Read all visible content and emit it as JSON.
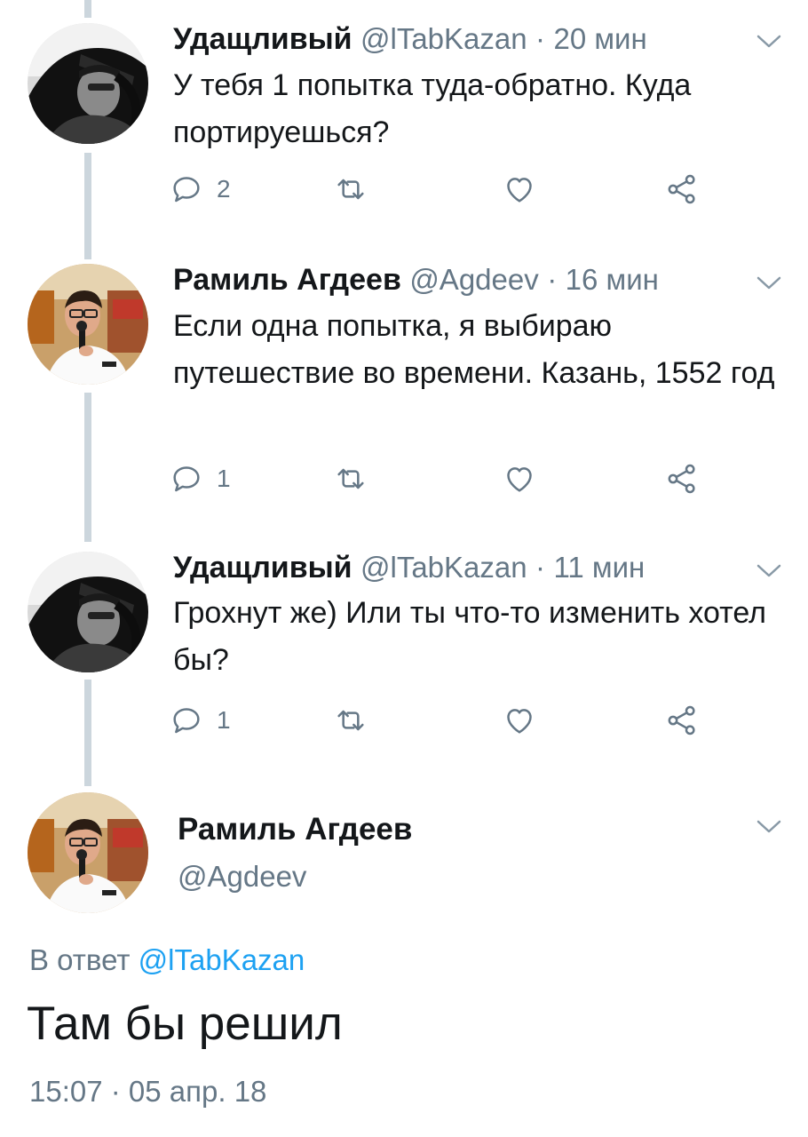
{
  "tweets": [
    {
      "name": "Удащливый",
      "handle": "@lTabKazan",
      "separator": "·",
      "time": "20 мин",
      "text": "У тебя 1 попытка туда-обратно. Куда портируешься?",
      "reply_count": "2",
      "avatar": "grayscale-driver-photo"
    },
    {
      "name": "Рамиль Агдеев",
      "handle": "@Agdeev",
      "separator": "·",
      "time": "16 мин",
      "text": "Если одна попытка, я выбираю путешествие во времени. Казань, 1552 год",
      "reply_count": "1",
      "avatar": "speaker-with-microphone-photo"
    },
    {
      "name": "Удащливый",
      "handle": "@lTabKazan",
      "separator": "·",
      "time": "11 мин",
      "text": "Грохнут же) Или ты что-то изменить хотел бы?",
      "reply_count": "1",
      "avatar": "grayscale-driver-photo"
    }
  ],
  "main_tweet": {
    "name": "Рамиль Агдеев",
    "handle": "@Agdeev",
    "reply_prefix": "В ответ",
    "reply_mention": "@lTabKazan",
    "text": "Там бы решил",
    "timestamp": "15:07 · 05 апр. 18",
    "avatar": "speaker-with-microphone-photo"
  },
  "icons": {
    "reply": "reply-icon",
    "retweet": "retweet-icon",
    "like": "heart-icon",
    "share": "share-icon",
    "menu": "chevron-down-icon"
  },
  "colors": {
    "text": "#14171a",
    "secondary": "#657786",
    "link": "#1da1f2",
    "thread_line": "#ccd6dd"
  }
}
